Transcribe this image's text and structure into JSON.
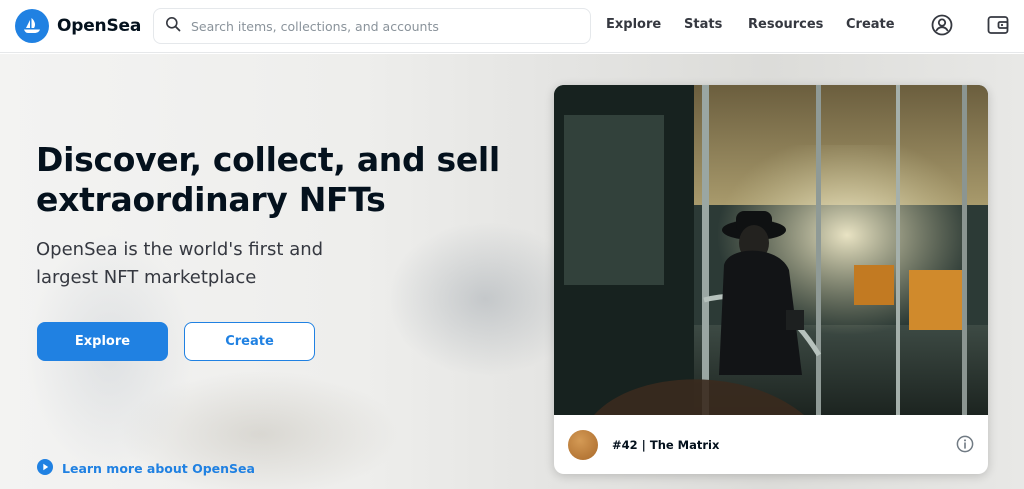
{
  "nav": {
    "brand": "OpenSea",
    "search_placeholder": "Search items, collections, and accounts",
    "links": [
      "Explore",
      "Stats",
      "Resources",
      "Create"
    ],
    "icons": [
      "profile-icon",
      "wallet-icon"
    ]
  },
  "hero": {
    "title": "Discover, collect, and sell extraordinary NFTs",
    "subtitle": "OpenSea is the world's first and largest NFT marketplace",
    "explore_label": "Explore",
    "create_label": "Create",
    "learn_more": "Learn more about OpenSea"
  },
  "featured": {
    "title": "#42 | The Matrix"
  },
  "colors": {
    "accent": "#2081e2",
    "text": "#04111d"
  }
}
